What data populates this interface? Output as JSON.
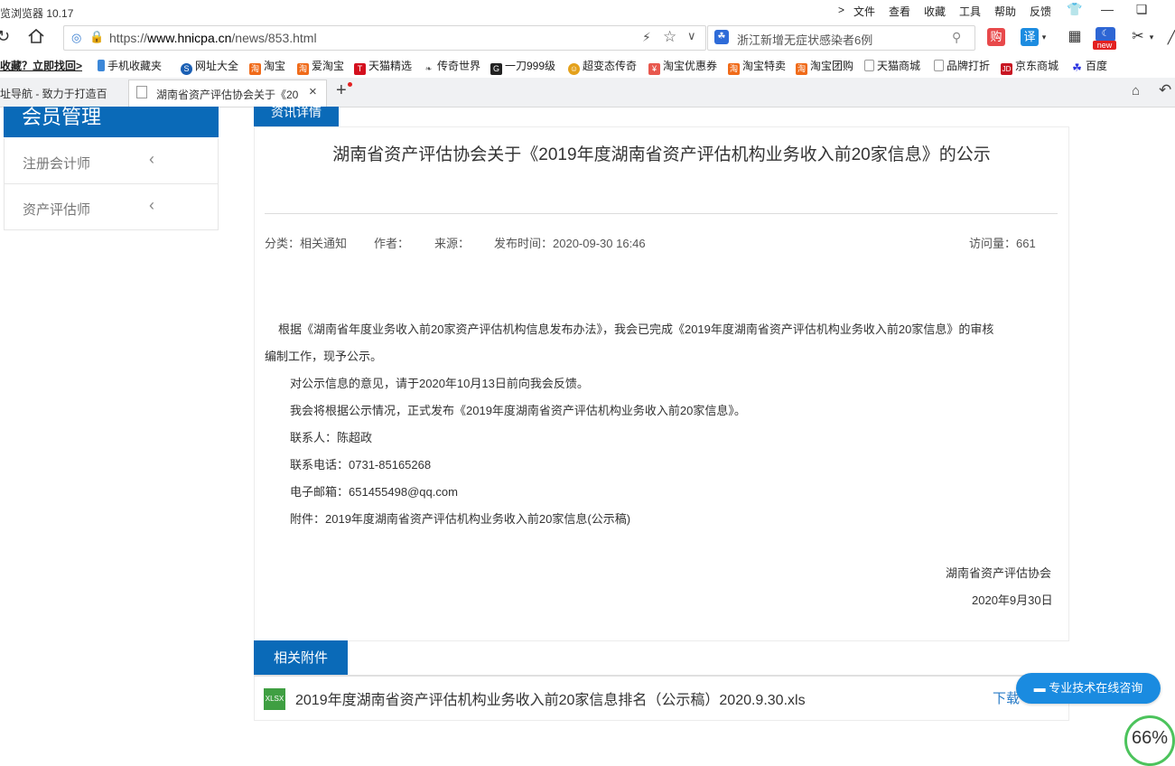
{
  "window": {
    "app_title": "览浏览器 10.17",
    "menu": [
      "文件",
      "查看",
      "收藏",
      "工具",
      "帮助",
      "反馈"
    ],
    "menu_chevron": ">"
  },
  "navbar": {
    "url_scheme": "https://",
    "url_host": "www.hnicpa.cn",
    "url_path": "/news/853.html",
    "search_text": "浙江新增无症状感染者6例",
    "buy_label": "购",
    "translate_label": "译",
    "new_badge": "new"
  },
  "bookmarks": [
    {
      "label": "收藏？立即找回>",
      "icon": "none",
      "color": "#ffffff"
    },
    {
      "label": "手机收藏夹",
      "icon": "phone-icon",
      "color": "#3b87d8"
    },
    {
      "label": "网址大全",
      "icon": "globe-icon",
      "color": "#1a5fb4"
    },
    {
      "label": "淘宝",
      "icon": "taobao-icon",
      "color": "#f06b1a"
    },
    {
      "label": "爱淘宝",
      "icon": "taobao-icon",
      "color": "#f06b1a"
    },
    {
      "label": "天猫精选",
      "icon": "tmall-icon",
      "color": "#d4101e"
    },
    {
      "label": "传奇世界",
      "icon": "game-icon",
      "color": "#555555"
    },
    {
      "label": "一刀999级",
      "icon": "game-icon",
      "color": "#222222"
    },
    {
      "label": "超变态传奇",
      "icon": "coin-icon",
      "color": "#e4a11b"
    },
    {
      "label": "淘宝优惠券",
      "icon": "coupon-icon",
      "color": "#e8584e"
    },
    {
      "label": "淘宝特卖",
      "icon": "taobao-icon",
      "color": "#f06b1a"
    },
    {
      "label": "淘宝团购",
      "icon": "taobao-icon",
      "color": "#f06b1a"
    },
    {
      "label": "天猫商城",
      "icon": "page-icon",
      "color": "#999999"
    },
    {
      "label": "品牌打折",
      "icon": "page-icon",
      "color": "#999999"
    },
    {
      "label": "京东商城",
      "icon": "jd-icon",
      "color": "#c81623"
    },
    {
      "label": "百度",
      "icon": "baidu-icon",
      "color": "#2932e1"
    }
  ],
  "tabs": [
    {
      "label": "址导航 - 致力于打造百"
    },
    {
      "label": "湖南省资产评估协会关于《20"
    }
  ],
  "tab_close": "×",
  "new_tab": "+",
  "sidebar": {
    "title": "会员管理",
    "items": [
      {
        "label": "注册会计师"
      },
      {
        "label": "资产评估师"
      }
    ]
  },
  "article": {
    "section_label": "资讯详情",
    "title": "湖南省资产评估协会关于《2019年度湖南省资产评估机构业务收入前20家信息》的公示",
    "category": "分类：相关通知",
    "author": "作者：",
    "source": "来源：",
    "published": "发布时间：2020-09-30 16:46",
    "visits": "访问量：661",
    "paragraphs": [
      "根据《湖南省年度业务收入前20家资产评估机构信息发布办法》，我会已完成《2019年度湖南省资产评估机构业务收入前20家信息》的审核",
      "编制工作，现予公示。",
      "对公示信息的意见，请于2020年10月13日前向我会反馈。",
      "我会将根据公示情况，正式发布《2019年度湖南省资产评估机构业务收入前20家信息》。",
      "联系人：陈超政",
      "联系电话：0731-85165268",
      "电子邮箱：651455498@qq.com",
      "附件：2019年度湖南省资产评估机构业务收入前20家信息(公示稿)"
    ],
    "signature_org": "湖南省资产评估协会",
    "signature_date": "2020年9月30日"
  },
  "attachments": {
    "label": "相关附件",
    "file_type": "XLSX",
    "file_name": "2019年度湖南省资产评估机构业务收入前20家信息排名（公示稿）2020.9.30.xls",
    "download_label": "下载"
  },
  "consult_button": "专业技术在线咨询",
  "speed_widget": "66%"
}
